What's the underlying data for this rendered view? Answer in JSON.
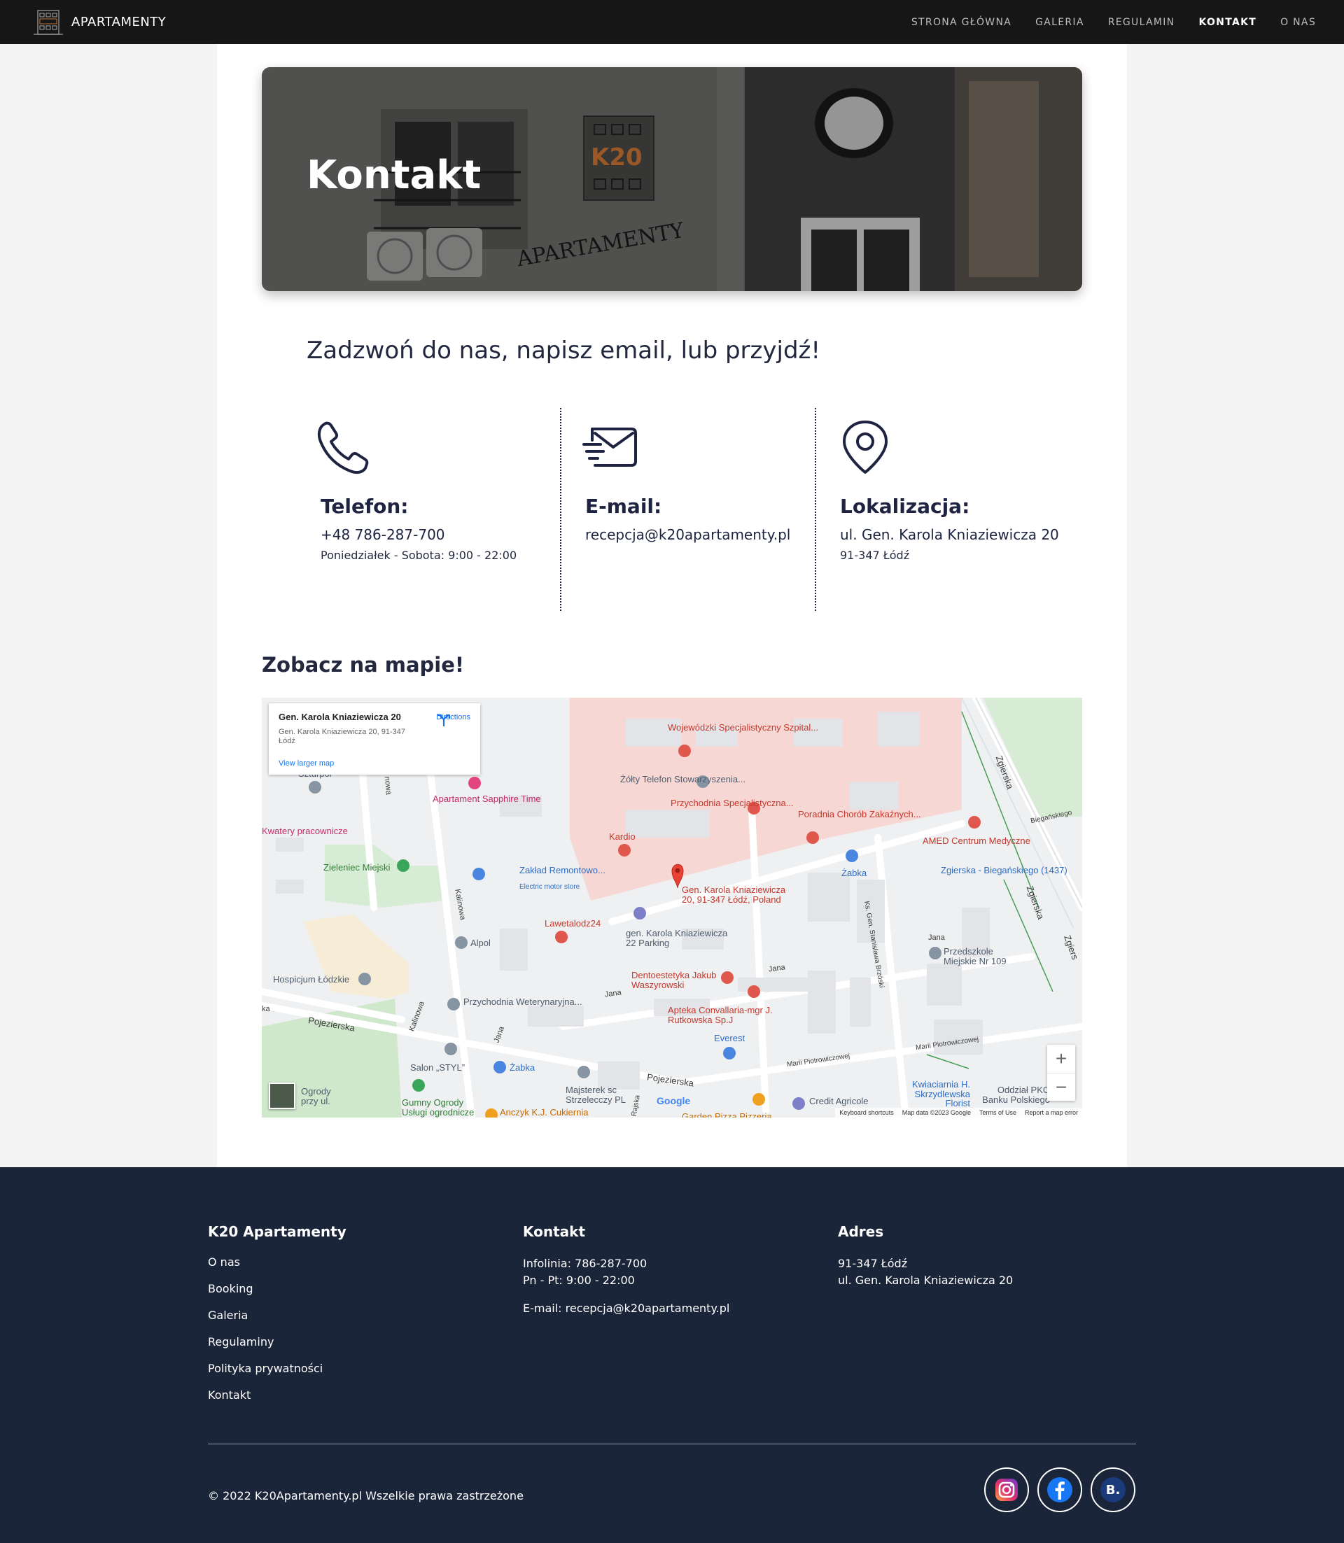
{
  "nav": {
    "brand": "APARTAMENTY",
    "links": [
      "STRONA GŁÓWNA",
      "GALERIA",
      "REGULAMIN",
      "KONTAKT",
      "O NAS"
    ],
    "active": "KONTAKT"
  },
  "hero": {
    "title": "Kontakt",
    "sign_text": "APARTAMENTY",
    "logo_text": "K20"
  },
  "lead": "Zadzwoń do nas, napisz email, lub przyjdź!",
  "contact": {
    "phone": {
      "label": "Telefon:",
      "value": "+48 786-287-700",
      "sub": "Poniedziałek - Sobota: 9:00 - 22:00",
      "icon": "phone-icon"
    },
    "email": {
      "label": "E-mail:",
      "value": "recepcja@k20apartamenty.pl",
      "icon": "envelope-icon"
    },
    "location": {
      "label": "Lokalizacja:",
      "value": "ul. Gen. Karola Kniaziewicza 20",
      "sub": "91-347 Łódź",
      "icon": "map-pin-icon"
    }
  },
  "map": {
    "title": "Zobacz na mapie!",
    "card": {
      "name": "Gen. Karola Kniaziewicza 20",
      "address": "Gen. Karola Kniaziewicza 20, 91-347 Łódź",
      "directions": "Directions",
      "larger": "View larger map"
    },
    "labels": {
      "hospital": "Wojewódzki Specjalistyczny Szpital...",
      "zolty": "Żółty Telefon Stowarzyszenia...",
      "przychodnia": "Przychodnia Specjalistyczna...",
      "poradnia": "Poradnia Chorób Zakaźnych...",
      "amed": "AMED Centrum Medyczne",
      "kardio": "Kardio",
      "zabka1": "Żabka",
      "zgierska_stop": "Zgierska - Biegańskiego (1437)",
      "sapphire": "Apartament Sapphire Time",
      "szturpol": "Szturpol",
      "kwatery": "Kwatery pracownicze",
      "zieleniec": "Zieleniec Miejski",
      "zaklad": "Zakład Remontowo...",
      "electric": "Electric motor store",
      "pin": "Gen. Karola Kniaziewicza 20, 91-347 Łódź, Poland",
      "laweta": "Lawetalodz24",
      "parking": "gen. Karola Kniaziewicza 22 Parking",
      "alpol": "Alpol",
      "hospicjum": "Hospicjum Łódzkie",
      "weteryna": "Przychodnia Weterynaryjna...",
      "dento": "Dentoestetyka Jakub Waszyrowski",
      "apteka": "Apteka Convallaria-mgr J. Rutkowska Sp.J",
      "przedszkole": "Przedszkole Miejskie Nr 109",
      "everest": "Everest",
      "salon": "Salon „STYL”",
      "zabka2": "Żabka",
      "majsterek": "Majsterek sc Strzelecczy PL",
      "gumny": "Gumny Ogrody Usługi ogrodnicze",
      "anczyk": "Anczyk K.J. Cukiernia",
      "credit": "Credit Agricole",
      "kwiaciarnia": "Kwiaciarnia H. Skrzydlewska Florist",
      "pko": "Oddział PKO Banku Polskiego",
      "ogrody": "Ogrody przy ul. Zgierskiej",
      "pizza": "Garden Pizza Pizzeria",
      "road_zgierska": "Zgierska",
      "road_zgierska2": "Zgierska",
      "road_zgierska3": "Zgiers",
      "road_bieganskiego": "Biegańskiego",
      "road_pojezierska": "Pojezierska",
      "road_pojezierska2": "Pojezierska",
      "road_kalinowa": "Kalinowa",
      "road_kalinowa2": "Kalinowa",
      "road_jana": "Jana",
      "road_jana2": "Jana",
      "road_jana3": "Jana",
      "road_jana4": "Jana",
      "road_brzoski": "Ks. Gen. Stanisława Brzóski",
      "road_piotrowiczowej": "Marii Piotrowiczowej",
      "road_piotrowiczowej2": "Marii Piotrowiczowej",
      "road_rajska": "Rajska",
      "road_ka": "ka",
      "road_nowa": "nowa"
    },
    "zoom_in": "+",
    "zoom_out": "−",
    "google": "Google",
    "footer": [
      "Keyboard shortcuts",
      "Map data ©2023 Google",
      "Terms of Use",
      "Report a map error"
    ]
  },
  "footer": {
    "col1": {
      "title": "K20 Apartamenty",
      "links": [
        "O nas",
        "Booking",
        "Galeria",
        "Regulaminy",
        "Polityka prywatności",
        "Kontakt"
      ]
    },
    "col2": {
      "title": "Kontakt",
      "line1": "Infolinia: 786-287-700",
      "line2": "Pn - Pt: 9:00 - 22:00",
      "line3": "E-mail: recepcja@k20apartamenty.pl"
    },
    "col3": {
      "title": "Adres",
      "line1": "91-347 Łódź",
      "line2": "ul. Gen. Karola Kniaziewicza 20"
    },
    "copyright": "© 2022 K20Apartamenty.pl Wszelkie prawa zastrzeżone",
    "socials": [
      "instagram-icon",
      "facebook-icon",
      "booking-icon"
    ],
    "booking_letter": "B."
  },
  "colors": {
    "navy": "#1b2539",
    "text": "#1d2340",
    "nav_bg": "#161616",
    "map_red": "#ea4335",
    "map_blue": "#1a73e8"
  }
}
